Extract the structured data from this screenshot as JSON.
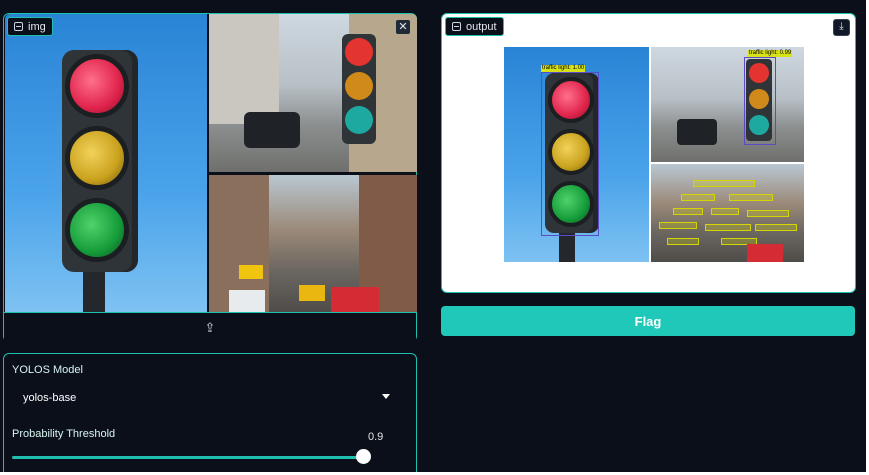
{
  "input_panel": {
    "tag_label": "img",
    "clear_icon": "close-icon",
    "upload_icon": "upload-icon"
  },
  "output_panel": {
    "tag_label": "output",
    "download_icon": "download-icon",
    "detections": [
      {
        "label": "traffic light: 1.00"
      },
      {
        "label": "traffic light: 0.99"
      }
    ]
  },
  "flag_button": {
    "label": "Flag"
  },
  "controls": {
    "model_label": "YOLOS Model",
    "model_value": "yolos-base",
    "threshold_label": "Probability Threshold",
    "threshold_value": "0.9"
  },
  "colors": {
    "accent": "#1fbfb0",
    "background": "#0b0f19",
    "flag": "#1fc8b8"
  }
}
